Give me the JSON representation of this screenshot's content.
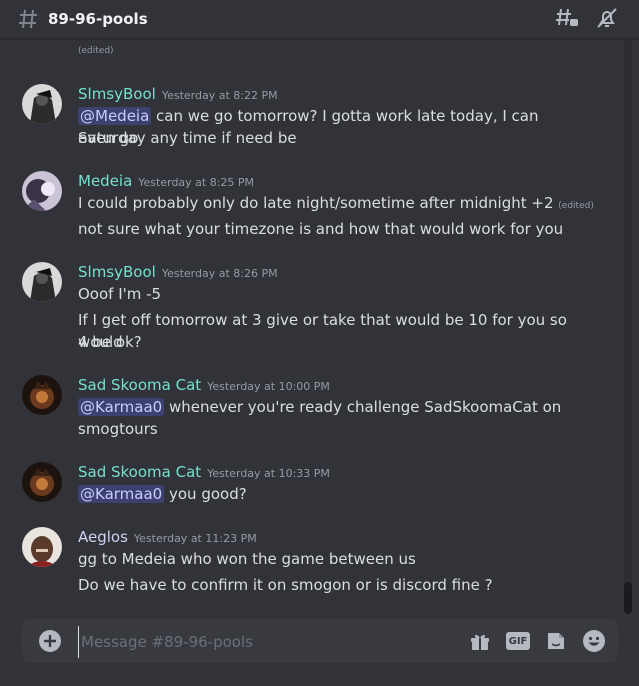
{
  "header": {
    "channel_name": "89-96-pools",
    "icons": [
      "hash-icon",
      "threads-icon",
      "notifications-muted-icon"
    ]
  },
  "colors": {
    "background": "#313338",
    "author_teal": "#76e0cf",
    "author_light": "#cdd3f5",
    "mention_bg": "#3f4475",
    "composer_bg": "#383a40"
  },
  "top_edited": "(edited)",
  "messages": [
    {
      "author": "SlmsyBool",
      "timestamp": "Yesterday at 8:22 PM",
      "lines": [
        {
          "mention": "@Medeia",
          "text": " can we go tomorrow? I gotta work late today, I can even go"
        },
        {
          "text": "Saturday any time if need be"
        }
      ]
    },
    {
      "author": "Medeia",
      "timestamp": "Yesterday at 8:25 PM",
      "lines": [
        {
          "text": "I could probably only do late night/sometime after midnight +2",
          "edited": "(edited)"
        },
        {
          "text": "not sure what your timezone is and how that would work for you"
        }
      ]
    },
    {
      "author": "SlmsyBool",
      "timestamp": "Yesterday at 8:26 PM",
      "lines": [
        {
          "text": "Ooof I'm -5"
        },
        {
          "text": "If I get off tomorrow at 3 give or take that would be 10 for you so would"
        },
        {
          "text": "4 be ok?"
        }
      ]
    },
    {
      "author": "Sad Skooma Cat",
      "timestamp": "Yesterday at 10:00 PM",
      "lines": [
        {
          "mention": "@Karmaa0",
          "text": " whenever you're ready challenge SadSkoomaCat on"
        },
        {
          "text": "smogtours"
        }
      ]
    },
    {
      "author": "Sad Skooma Cat",
      "timestamp": "Yesterday at 10:33 PM",
      "lines": [
        {
          "mention": "@Karmaa0",
          "text": " you good?"
        }
      ]
    },
    {
      "author": "Aeglos",
      "timestamp": "Yesterday at 11:23 PM",
      "lines": [
        {
          "text": "gg to Medeia who won the game between us"
        },
        {
          "text": "Do we have to confirm it on smogon or is discord fine ?"
        }
      ]
    }
  ],
  "composer": {
    "placeholder": "Message #89-96-pools",
    "value": "",
    "gif_label": "GIF",
    "icons": [
      "plus-icon",
      "gift-icon",
      "gif-icon",
      "sticker-icon",
      "emoji-icon"
    ]
  }
}
